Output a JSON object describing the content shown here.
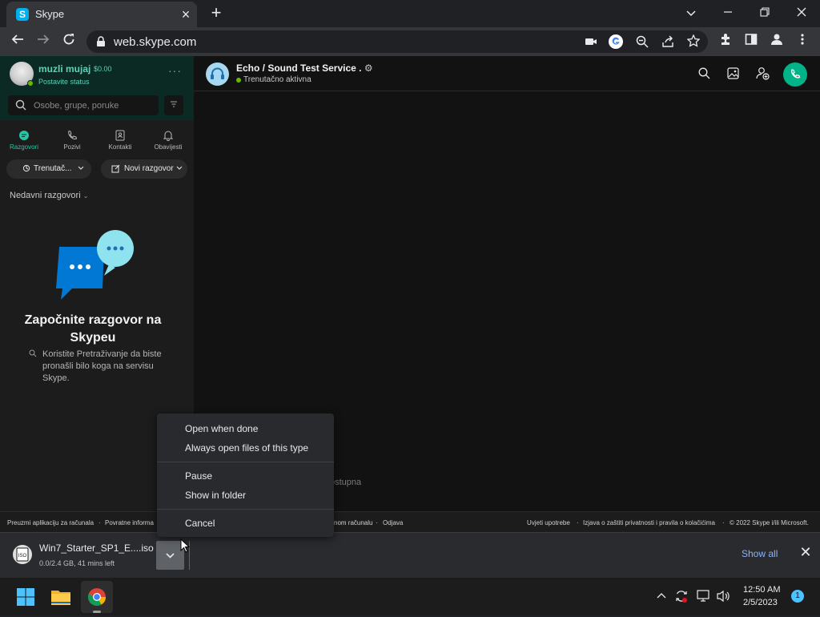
{
  "browser": {
    "tab_title": "Skype",
    "tab_favicon": "S",
    "url": "web.skype.com"
  },
  "skype": {
    "user": {
      "name": "muzli mujaj",
      "credit": "$0.00",
      "status_prompt": "Postavite status"
    },
    "search_placeholder": "Osobe, grupe, poruke",
    "nav_tabs": [
      {
        "label": "Razgovori",
        "icon": "chat-icon",
        "active": true
      },
      {
        "label": "Pozivi",
        "icon": "phone-icon",
        "active": false
      },
      {
        "label": "Kontakti",
        "icon": "contacts-icon",
        "active": false
      },
      {
        "label": "Obavijesti",
        "icon": "bell-icon",
        "active": false
      }
    ],
    "presence_button": "Trenutač...",
    "new_chat_button": "Novi razgovor",
    "recent_label": "Nedavni razgovori",
    "empty_state": {
      "title": "Započnite razgovor na Skypeu",
      "description": "Koristite Pretraživanje da biste pronašli bilo koga na servisu Skype."
    },
    "chat": {
      "name": "Echo / Sound Test Service .",
      "status": "Trenutačno aktivna",
      "partial_text": "ostupna"
    },
    "footer": {
      "left_links": [
        "Preuzmi aplikaciju za računala",
        "Povratne informa"
      ],
      "middle_links": [
        "nom računalu",
        "Odjava"
      ],
      "right_links": [
        "Uvjeti upotrebe",
        "Izjava o zaštiti privatnosti i pravila o kolačićima",
        "© 2022 Skype i/ili Microsoft."
      ]
    }
  },
  "download": {
    "filename": "Win7_Starter_SP1_E....iso",
    "progress": "0.0/2.4 GB, 41 mins left",
    "show_all": "Show all",
    "file_icon_label": "ISO"
  },
  "context_menu": {
    "items": [
      "Open when done",
      "Always open files of this type",
      "Pause",
      "Show in folder",
      "Cancel"
    ]
  },
  "taskbar": {
    "time": "12:50 AM",
    "date": "2/5/2023",
    "notification_count": "1"
  },
  "colors": {
    "skype_accent": "#5cd3b7",
    "call_button": "#00b388",
    "link_blue": "#8ab4f8"
  }
}
